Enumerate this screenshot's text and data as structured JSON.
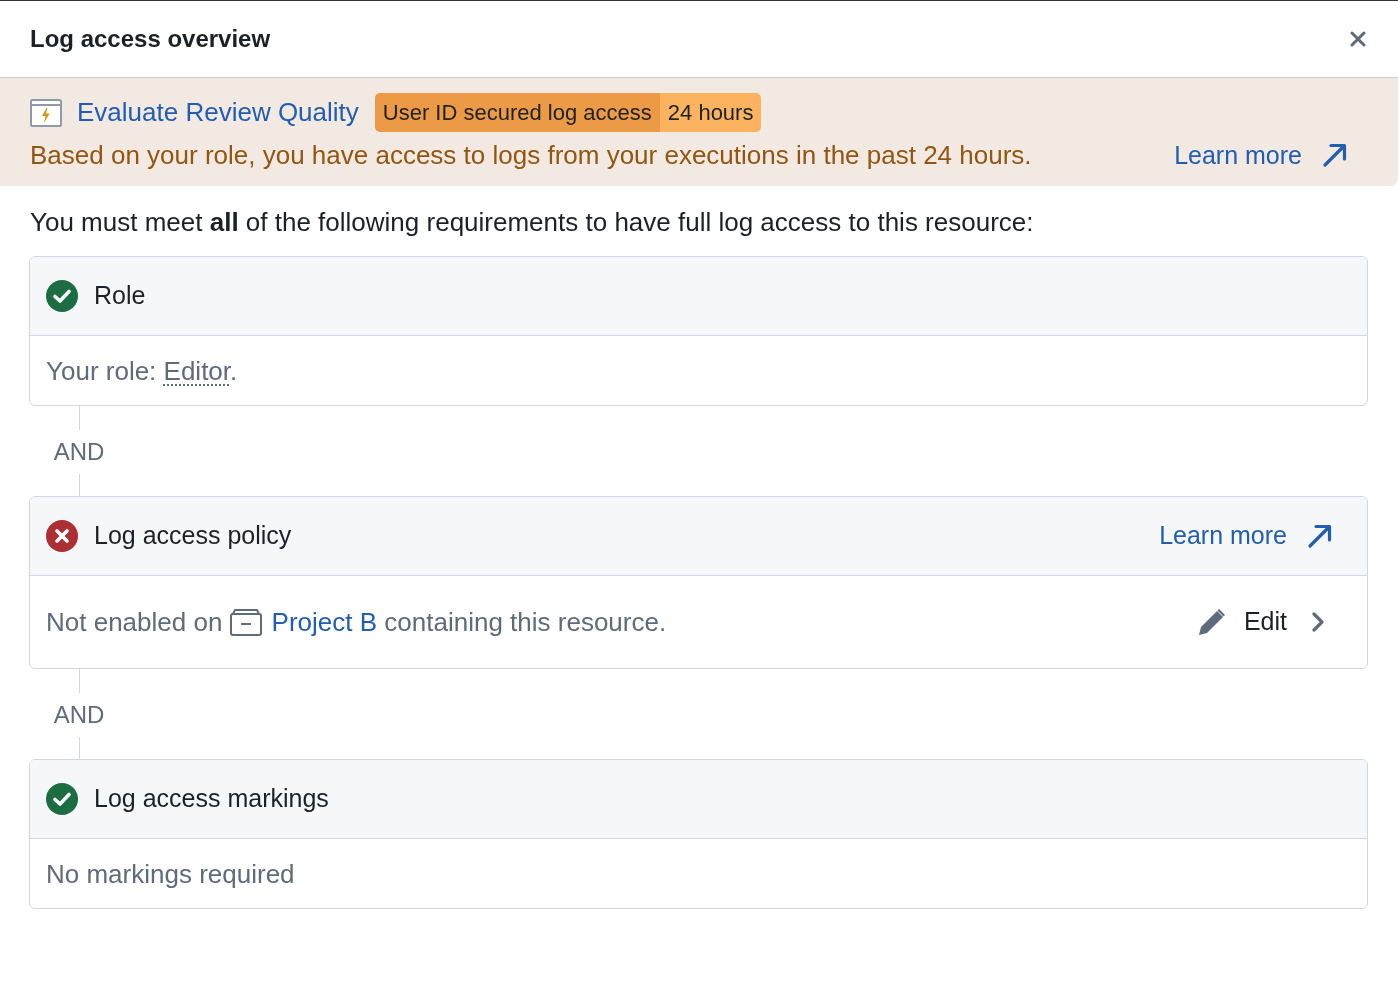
{
  "dialog": {
    "title": "Log access overview"
  },
  "banner": {
    "resource": "Evaluate Review Quality",
    "tag": {
      "label": "User ID secured log access",
      "value": "24 hours"
    },
    "message": "Based on your role, you have access to logs from your executions in the past 24 hours.",
    "link": "Learn more"
  },
  "intro": "You must meet **all** of the following requirements to have full log access to this resource:",
  "requirements": [
    {
      "title": "Role",
      "met": true,
      "body": [
        {
          "kind": "text",
          "text": "Your role: "
        },
        {
          "kind": "term",
          "text": "Editor"
        },
        {
          "kind": "text",
          "text": "."
        }
      ]
    },
    {
      "joiner": "AND",
      "title": "Log access policy",
      "met": false,
      "link": "Learn more",
      "body": [
        {
          "kind": "text",
          "text": "Not enabled on "
        },
        {
          "kind": "project",
          "text": "Project B"
        },
        {
          "kind": "text",
          "text": " containing this resource."
        }
      ],
      "action": "Edit"
    },
    {
      "joiner": "AND",
      "title": "Log access markings",
      "met": true,
      "body": [
        {
          "kind": "text",
          "text": "No markings required"
        }
      ]
    }
  ]
}
